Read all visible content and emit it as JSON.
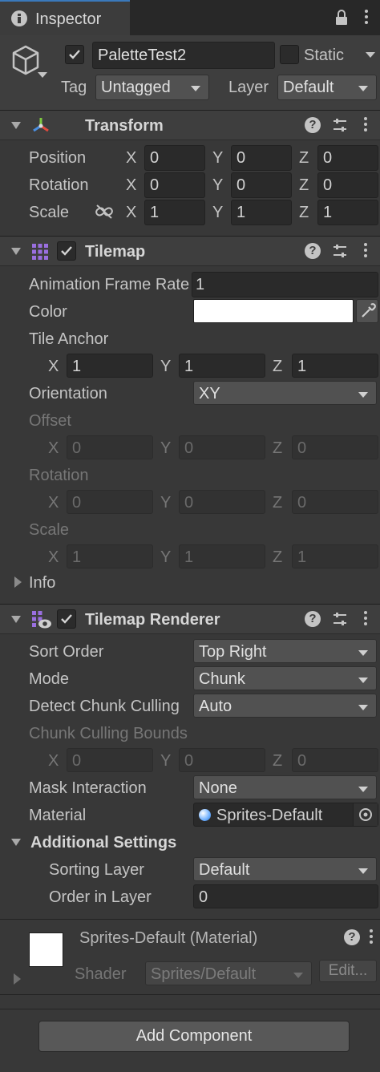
{
  "tab": {
    "title": "Inspector"
  },
  "object": {
    "name": "PaletteTest2",
    "static_label": "Static",
    "tag_label": "Tag",
    "tag_value": "Untagged",
    "layer_label": "Layer",
    "layer_value": "Default"
  },
  "transform": {
    "title": "Transform",
    "rows": [
      {
        "label": "Position",
        "x": "0",
        "y": "0",
        "z": "0"
      },
      {
        "label": "Rotation",
        "x": "0",
        "y": "0",
        "z": "0"
      },
      {
        "label": "Scale",
        "x": "1",
        "y": "1",
        "z": "1"
      }
    ]
  },
  "axis": {
    "x": "X",
    "y": "Y",
    "z": "Z"
  },
  "tilemap": {
    "title": "Tilemap",
    "anim_label": "Animation Frame Rate",
    "anim_value": "1",
    "color_label": "Color",
    "anchor_label": "Tile Anchor",
    "anchor": {
      "x": "1",
      "y": "1",
      "z": "1"
    },
    "orientation_label": "Orientation",
    "orientation_value": "XY",
    "offset_label": "Offset",
    "offset": {
      "x": "0",
      "y": "0",
      "z": "0"
    },
    "rotation_label": "Rotation",
    "rotation": {
      "x": "0",
      "y": "0",
      "z": "0"
    },
    "scale_label": "Scale",
    "scale": {
      "x": "1",
      "y": "1",
      "z": "1"
    },
    "info_label": "Info"
  },
  "renderer": {
    "title": "Tilemap Renderer",
    "sort_label": "Sort Order",
    "sort_value": "Top Right",
    "mode_label": "Mode",
    "mode_value": "Chunk",
    "culling_label": "Detect Chunk Culling",
    "culling_value": "Auto",
    "bounds_label": "Chunk Culling Bounds",
    "bounds": {
      "x": "0",
      "y": "0",
      "z": "0"
    },
    "mask_label": "Mask Interaction",
    "mask_value": "None",
    "material_label": "Material",
    "material_value": "Sprites-Default",
    "additional_label": "Additional Settings",
    "sorting_layer_label": "Sorting Layer",
    "sorting_layer_value": "Default",
    "order_label": "Order in Layer",
    "order_value": "0"
  },
  "material": {
    "title": "Sprites-Default (Material)",
    "shader_label": "Shader",
    "shader_value": "Sprites/Default",
    "edit_label": "Edit..."
  },
  "add_component": "Add Component",
  "colors": {
    "background": "#383838",
    "header": "#3e3e3e",
    "field": "#2a2a2a",
    "dropdown": "#515151"
  }
}
